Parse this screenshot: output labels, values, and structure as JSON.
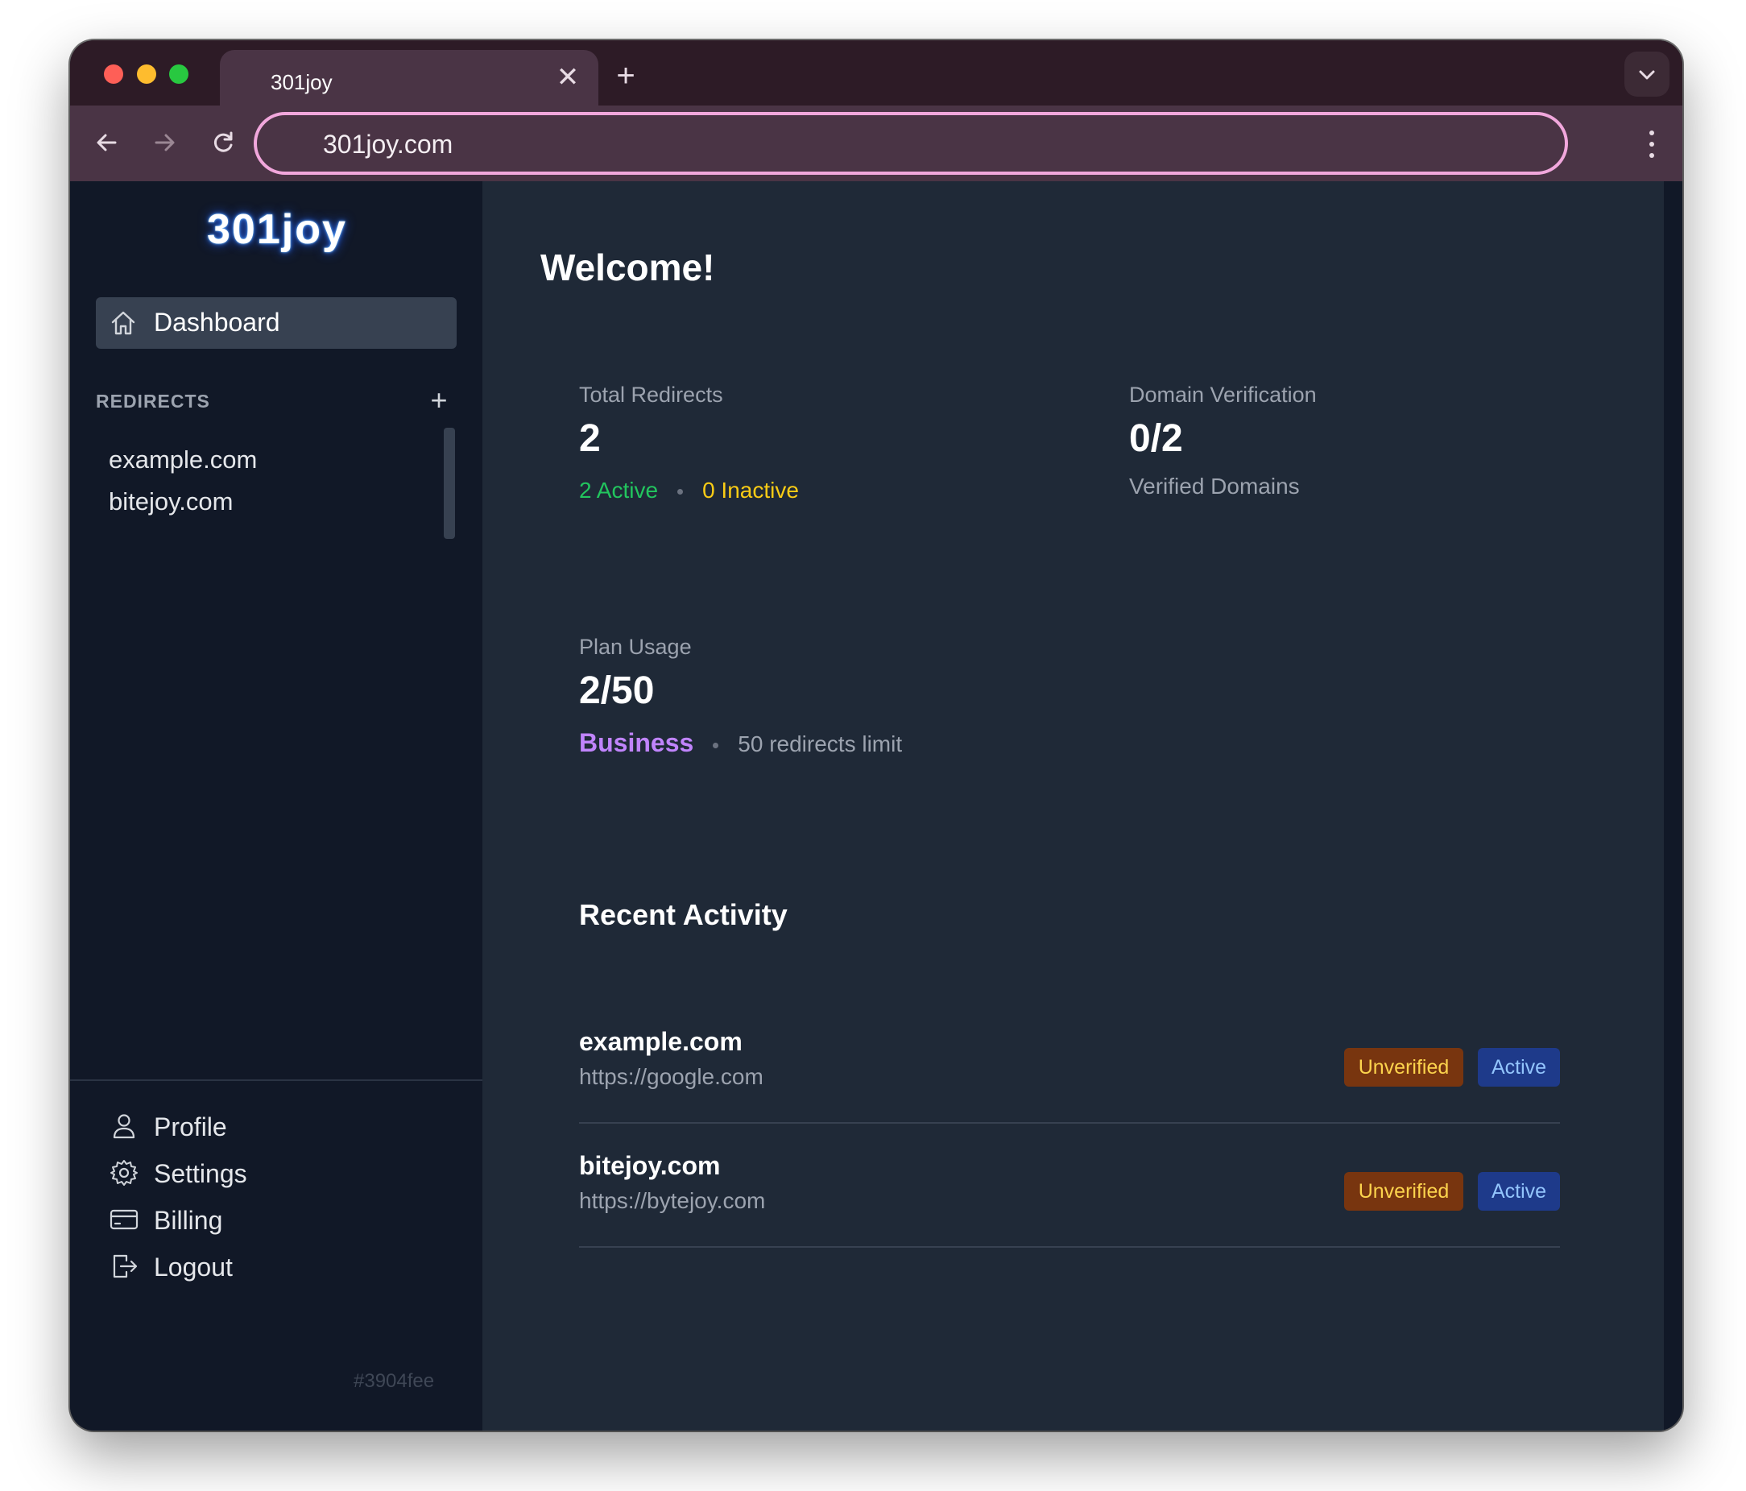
{
  "browser": {
    "tab_title": "301joy",
    "tab_close": "✕",
    "new_tab": "+",
    "url": "301joy.com"
  },
  "sidebar": {
    "logo": "301joy",
    "dashboard_label": "Dashboard",
    "redirects_header": "REDIRECTS",
    "redirects_add": "+",
    "redirects": [
      {
        "label": "example.com"
      },
      {
        "label": "bitejoy.com"
      }
    ],
    "links": [
      {
        "label": "Profile",
        "icon": "user-icon"
      },
      {
        "label": "Settings",
        "icon": "gear-icon"
      },
      {
        "label": "Billing",
        "icon": "credit-card-icon"
      },
      {
        "label": "Logout",
        "icon": "logout-icon"
      }
    ],
    "build_hash": "#3904fee"
  },
  "main": {
    "welcome": "Welcome!",
    "total_redirects": {
      "label": "Total Redirects",
      "value": "2",
      "active": "2 Active",
      "inactive": "0 Inactive"
    },
    "domain_verification": {
      "label": "Domain Verification",
      "value": "0/2",
      "sub": "Verified Domains"
    },
    "plan_usage": {
      "label": "Plan Usage",
      "value": "2/50",
      "plan": "Business",
      "limit": "50 redirects limit"
    },
    "recent_activity": {
      "title": "Recent Activity",
      "items": [
        {
          "domain": "example.com",
          "target": "https://google.com",
          "verification": "Unverified",
          "status": "Active"
        },
        {
          "domain": "bitejoy.com",
          "target": "https://bytejoy.com",
          "verification": "Unverified",
          "status": "Active"
        }
      ]
    }
  },
  "colors": {
    "sidebar_bg": "#111827",
    "main_bg": "#1f2937",
    "active_green": "#22c55e",
    "inactive_yellow": "#facc15",
    "plan_purple": "#c084fc",
    "address_border": "#f1a7dc"
  }
}
